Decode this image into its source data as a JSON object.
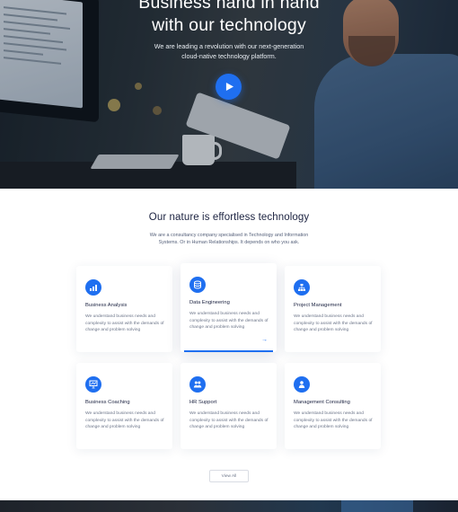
{
  "hero": {
    "title_line1": "Business hand in hand",
    "title_line2": "with our technology",
    "subtitle_line1": "We are leading a revolution with our next-generation",
    "subtitle_line2": "cloud-native technology platform.",
    "play_icon": "play-icon"
  },
  "section": {
    "title": "Our nature is effortless technology",
    "description_line1": "We are a consultancy company specialised in Technology and Information",
    "description_line2": "Systems. Or in Human Relationships. It depends on who you ask."
  },
  "cards": [
    {
      "title": "Business Analysis",
      "text": "We understand business needs and complexity to assist with the demands of change and problem solving",
      "icon": "chart-icon"
    },
    {
      "title": "Data Engineering",
      "text": "We understand business needs and complexity to assist with the demands of change and problem solving",
      "icon": "database-icon",
      "arrow": "→"
    },
    {
      "title": "Project Management",
      "text": "We understand business needs and complexity to assist with the demands of change and problem solving",
      "icon": "org-chart-icon"
    },
    {
      "title": "Business Coaching",
      "text": "We understand business needs and complexity to assist with the demands of change and problem solving",
      "icon": "coaching-icon"
    },
    {
      "title": "HR Support",
      "text": "We understand business needs and complexity to assist with the demands of change and problem solving",
      "icon": "people-icon"
    },
    {
      "title": "Management Consulting",
      "text": "We understand business needs and complexity to assist with the demands of change and problem solving",
      "icon": "consulting-icon"
    }
  ],
  "view_all_label": "View All",
  "colors": {
    "accent": "#1f6ff0",
    "heading": "#1b2240",
    "body_text": "#6b7488"
  }
}
